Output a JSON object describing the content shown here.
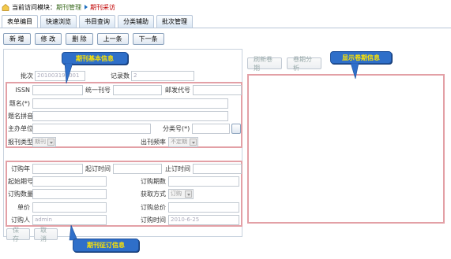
{
  "breadcrumb": {
    "prefix": "当前访问模块：",
    "module": "期刊管理",
    "current": "期刊采访"
  },
  "tabs": [
    "表单编目",
    "快速浏览",
    "书目查询",
    "分类辅助",
    "批次管理"
  ],
  "toolbar": [
    "新 增",
    "修 改",
    "删 除",
    "上一条",
    "下一条"
  ],
  "form": {
    "batch_label": "批次",
    "batch_value": "201003190001",
    "record_no_label": "记录数",
    "record_no_value": "2",
    "issn_label": "ISSN",
    "unified_no_label": "统一刊号",
    "postal_code_label": "邮发代号",
    "title_label": "题名(*)",
    "pinyin_label": "题名拼音",
    "sponsor_label": "主办单位",
    "class_no_label": "分类号(*)",
    "journal_type_label": "报刊类型",
    "journal_type_value": "期刊",
    "frequency_label": "出刊频率",
    "frequency_value": "不定期",
    "order_year_label": "订购年",
    "start_time_label": "起订时间",
    "end_time_label": "止订时间",
    "start_issue_label": "起始期号",
    "order_issues_label": "订购期数",
    "order_qty_label": "订购数量",
    "acquire_mode_label": "获取方式",
    "acquire_mode_value": "订购",
    "unit_price_label": "单价",
    "total_price_label": "订购总价",
    "orderer_label": "订购人",
    "orderer_value": "admin",
    "order_time_label": "订购时间",
    "order_time_value": "2010-6-25"
  },
  "bottom_buttons": [
    "保 存",
    "取 消"
  ],
  "right_buttons": [
    "刷新卷期",
    "卷期分析"
  ],
  "callouts": {
    "basic_info": "期刊基本信息",
    "volume_info": "显示卷期信息",
    "order_info": "期刊征订信息"
  }
}
